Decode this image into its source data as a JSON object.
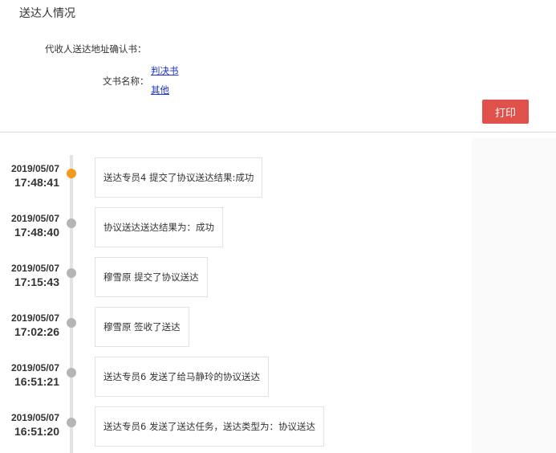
{
  "page": {
    "title": "送达人情况",
    "proxy_label": "代收人送达地址确认书："
  },
  "documents": {
    "label": "文书名称：",
    "links": [
      "判决书",
      "其他"
    ]
  },
  "actions": {
    "print_label": "打印"
  },
  "timeline": {
    "active_color": "#f39a1c",
    "inactive_color": "#b5b5b5",
    "items": [
      {
        "date": "2019/05/07",
        "time": "17:48:41",
        "text": "送达专员4 提交了协议送达结果:成功",
        "active": true
      },
      {
        "date": "2019/05/07",
        "time": "17:48:40",
        "text": "协议送达送达结果为：成功",
        "active": false
      },
      {
        "date": "2019/05/07",
        "time": "17:15:43",
        "text": "穆雪原 提交了协议送达",
        "active": false
      },
      {
        "date": "2019/05/07",
        "time": "17:02:26",
        "text": "穆雪原 签收了送达",
        "active": false
      },
      {
        "date": "2019/05/07",
        "time": "16:51:21",
        "text": "送达专员6 发送了给马静玲的协议送达",
        "active": false
      },
      {
        "date": "2019/05/07",
        "time": "16:51:20",
        "text": "送达专员6 发送了送达任务，送达类型为：协议送达",
        "active": false
      }
    ]
  }
}
